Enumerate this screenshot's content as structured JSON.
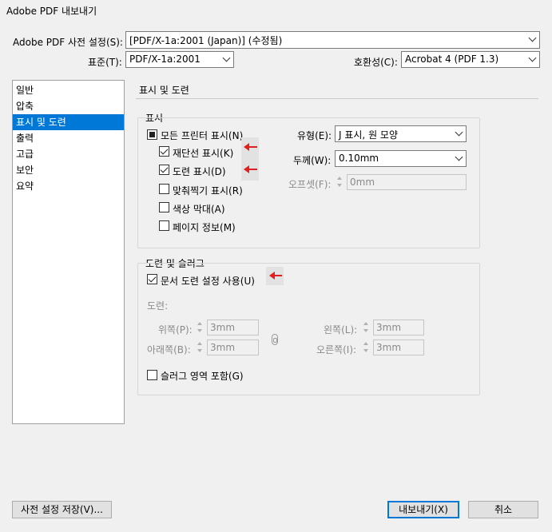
{
  "window": {
    "title": "Adobe PDF 내보내기"
  },
  "header": {
    "preset_label": "Adobe PDF 사전 설정(S):",
    "preset_value": "[PDF/X-1a:2001 (Japan)] (수정됨)",
    "standard_label": "표준(T):",
    "standard_value": "PDF/X-1a:2001",
    "compat_label": "호환성(C):",
    "compat_value": "Acrobat 4 (PDF 1.3)"
  },
  "sidebar": {
    "items": [
      {
        "label": "일반"
      },
      {
        "label": "압축"
      },
      {
        "label": "표시 및 도련"
      },
      {
        "label": "출력"
      },
      {
        "label": "고급"
      },
      {
        "label": "보안"
      },
      {
        "label": "요약"
      }
    ],
    "selected_index": 2
  },
  "main": {
    "section_title": "표시 및 도련",
    "marks": {
      "group_title": "표시",
      "all_printer_marks": "모든 프린터 표시(N)",
      "crop_marks": "재단선 표시(K)",
      "bleed_marks": "도련 표시(D)",
      "registration_marks": "맞춰찍기 표시(R)",
      "color_bars": "색상 막대(A)",
      "page_info": "페이지 정보(M)",
      "type_label": "유형(E):",
      "type_value": "J 표시, 원 모양",
      "weight_label": "두께(W):",
      "weight_value": "0.10mm",
      "offset_label": "오프셋(F):",
      "offset_value": "0mm"
    },
    "bleed": {
      "group_title": "도련 및 슬러그",
      "use_doc_bleed": "문서 도련 설정 사용(U)",
      "bleed_label": "도련:",
      "top_label": "위쪽(P):",
      "top_value": "3mm",
      "bottom_label": "아래쪽(B):",
      "bottom_value": "3mm",
      "left_label": "왼쪽(L):",
      "left_value": "3mm",
      "right_label": "오른쪽(I):",
      "right_value": "3mm",
      "include_slug": "슬러그 영역 포함(G)"
    }
  },
  "footer": {
    "save_preset": "사전 설정 저장(V)...",
    "export": "내보내기(X)",
    "cancel": "취소"
  },
  "colors": {
    "selection": "#0078d7",
    "arrow": "#e02020"
  }
}
